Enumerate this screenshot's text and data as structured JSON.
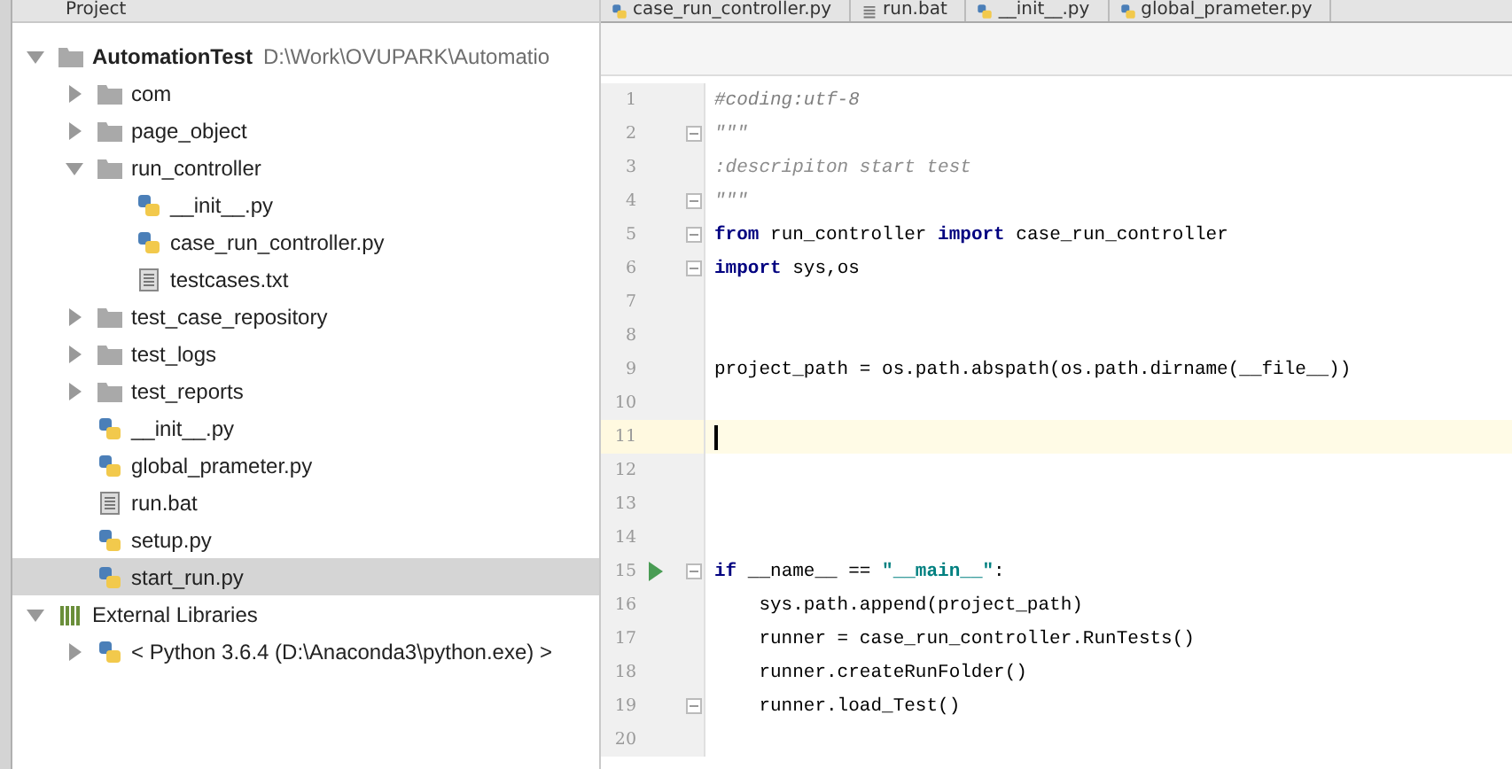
{
  "project_panel": {
    "title": "Project",
    "tree": [
      {
        "kind": "module",
        "label": "AutomationTest",
        "path": "D:\\Work\\OVUPARK\\Automatio",
        "expanded": true,
        "selected": false,
        "children": [
          {
            "kind": "folder",
            "label": "com",
            "expanded": false,
            "selected": false
          },
          {
            "kind": "folder",
            "label": "page_object",
            "expanded": false,
            "selected": false
          },
          {
            "kind": "folder",
            "label": "run_controller",
            "expanded": true,
            "selected": false,
            "children": [
              {
                "kind": "python",
                "label": "__init__.py",
                "selected": false
              },
              {
                "kind": "python",
                "label": "case_run_controller.py",
                "selected": false
              },
              {
                "kind": "text",
                "label": "testcases.txt",
                "selected": false
              }
            ]
          },
          {
            "kind": "folder",
            "label": "test_case_repository",
            "expanded": false,
            "selected": false
          },
          {
            "kind": "folder",
            "label": "test_logs",
            "expanded": false,
            "selected": false
          },
          {
            "kind": "folder",
            "label": "test_reports",
            "expanded": false,
            "selected": false
          },
          {
            "kind": "python",
            "label": "__init__.py",
            "selected": false
          },
          {
            "kind": "python",
            "label": "global_prameter.py",
            "selected": false
          },
          {
            "kind": "text",
            "label": "run.bat",
            "selected": false
          },
          {
            "kind": "python",
            "label": "setup.py",
            "selected": false
          },
          {
            "kind": "python",
            "label": "start_run.py",
            "selected": true
          }
        ]
      },
      {
        "kind": "libraries",
        "label": "External Libraries",
        "expanded": true,
        "selected": false,
        "children": [
          {
            "kind": "sdk",
            "label": "< Python 3.6.4 (D:\\Anaconda3\\python.exe) >",
            "expanded": false,
            "selected": false
          }
        ]
      }
    ]
  },
  "editor": {
    "tabs": [
      {
        "kind": "python",
        "label": "case_run_controller.py",
        "selected": false
      },
      {
        "kind": "text",
        "label": "run.bat",
        "selected": false
      },
      {
        "kind": "python",
        "label": "__init__.py",
        "selected": false
      },
      {
        "kind": "python",
        "label": "global_prameter.py",
        "selected": false
      }
    ],
    "lines": [
      {
        "number": "1",
        "segments": [
          {
            "kind": "comment",
            "text": "#coding:utf-8"
          }
        ]
      },
      {
        "number": "2",
        "fold": true,
        "segments": [
          {
            "kind": "doc",
            "text": "\"\"\""
          }
        ]
      },
      {
        "number": "3",
        "segments": [
          {
            "kind": "doc",
            "text": ":descripiton start test"
          }
        ]
      },
      {
        "number": "4",
        "fold": true,
        "segments": [
          {
            "kind": "doc",
            "text": "\"\"\""
          }
        ]
      },
      {
        "number": "5",
        "fold": true,
        "segments": [
          {
            "kind": "keyword",
            "text": "from"
          },
          {
            "kind": "plain",
            "text": " run_controller "
          },
          {
            "kind": "keyword",
            "text": "import"
          },
          {
            "kind": "plain",
            "text": " case_run_controller"
          }
        ]
      },
      {
        "number": "6",
        "fold": true,
        "segments": [
          {
            "kind": "keyword",
            "text": "import"
          },
          {
            "kind": "plain",
            "text": " sys,os"
          }
        ]
      },
      {
        "number": "7"
      },
      {
        "number": "8"
      },
      {
        "number": "9",
        "segments": [
          {
            "kind": "plain",
            "text": "project_path = os.path.abspath(os.path.dirname(__file__))"
          }
        ]
      },
      {
        "number": "10"
      },
      {
        "number": "11",
        "current": true
      },
      {
        "number": "12"
      },
      {
        "number": "13"
      },
      {
        "number": "14"
      },
      {
        "number": "15",
        "run": true,
        "fold": true,
        "segments": [
          {
            "kind": "keyword",
            "text": "if"
          },
          {
            "kind": "plain",
            "text": " __name__ == "
          },
          {
            "kind": "string",
            "text": "\"__main__\""
          },
          {
            "kind": "plain",
            "text": ":"
          }
        ]
      },
      {
        "number": "16",
        "segments": [
          {
            "kind": "plain",
            "text": "    sys.path.append(project_path)"
          }
        ]
      },
      {
        "number": "17",
        "segments": [
          {
            "kind": "plain",
            "text": "    runner = case_run_controller.RunTests()"
          }
        ]
      },
      {
        "number": "18",
        "segments": [
          {
            "kind": "plain",
            "text": "    runner.createRunFolder()"
          }
        ]
      },
      {
        "number": "19",
        "fold": true,
        "segments": [
          {
            "kind": "plain",
            "text": "    runner.load_Test()"
          }
        ]
      },
      {
        "number": "20"
      }
    ]
  }
}
